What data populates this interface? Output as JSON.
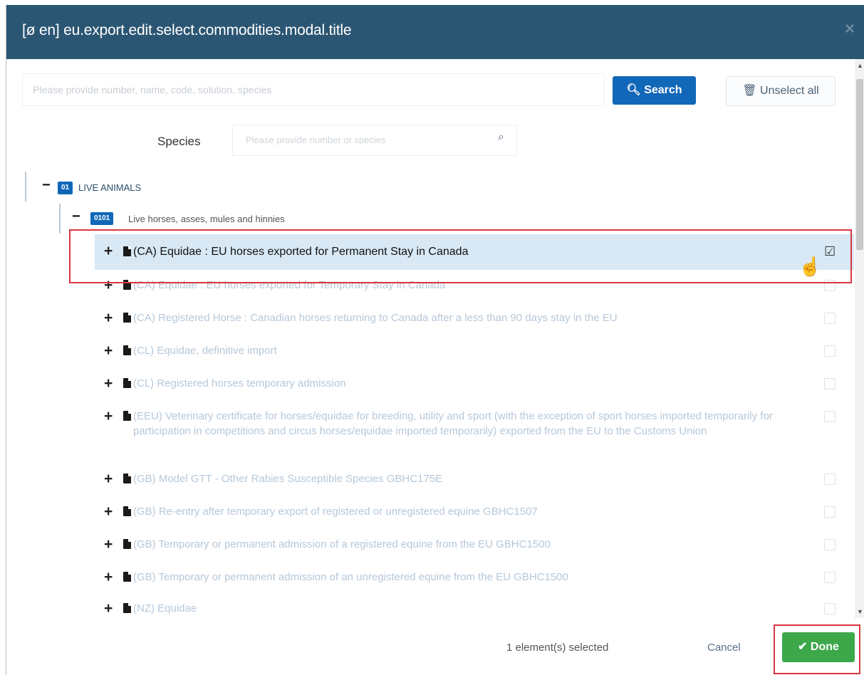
{
  "modal": {
    "title": "[ø en] eu.export.edit.select.commodities.modal.title",
    "close_icon": "×"
  },
  "search": {
    "placeholder": "Please provide number, name, code, solution, species",
    "button_label": "Search",
    "unselect_label": "Unselect all"
  },
  "species": {
    "label": "Species",
    "placeholder": "Please provide number or species"
  },
  "tree": {
    "root": {
      "code": "01",
      "label": "LIVE ANIMALS"
    },
    "group": {
      "code": "0101",
      "label": "Live horses, asses, mules and hinnies"
    },
    "items": [
      {
        "text": "(CA) Equidae : EU horses exported for Permanent Stay in Canada",
        "checked": true
      },
      {
        "text": "(CA) Equidae : EU horses exported for Temporary Stay in Canada",
        "checked": false
      },
      {
        "text": "(CA) Registered Horse : Canadian horses returning to Canada after a less than 90 days stay in the EU",
        "checked": false
      },
      {
        "text": "(CL) Equidae, definitive import",
        "checked": false
      },
      {
        "text": "(CL) Registered horses temporary admission",
        "checked": false
      },
      {
        "text": "(EEU) Veterinary certificate for horses/equidae for breeding, utility and sport (with the exception of sport horses imported temporarily for participation in competitions and circus horses/equidae imported temporarily) exported from the EU to the Customs Union",
        "checked": false
      },
      {
        "text": "(GB) Model GTT - Other Rabies Susceptible Species GBHC175E",
        "checked": false
      },
      {
        "text": "(GB) Re-entry after temporary export of registered or unregistered equine GBHC1507",
        "checked": false
      },
      {
        "text": "(GB) Temporary or permanent admission of a registered equine from the EU GBHC1500",
        "checked": false
      },
      {
        "text": "(GB) Temporary or permanent admission of an unregistered equine from the EU GBHC1500",
        "checked": false
      },
      {
        "text": "(NZ) Equidae",
        "checked": false
      }
    ]
  },
  "footer": {
    "selected_text": "1 element(s) selected",
    "cancel_label": "Cancel",
    "done_label": "Done"
  },
  "colors": {
    "header": "#2b5673",
    "primary": "#1167b8",
    "success": "#3ca84a",
    "highlight_box": "#d9363e"
  }
}
